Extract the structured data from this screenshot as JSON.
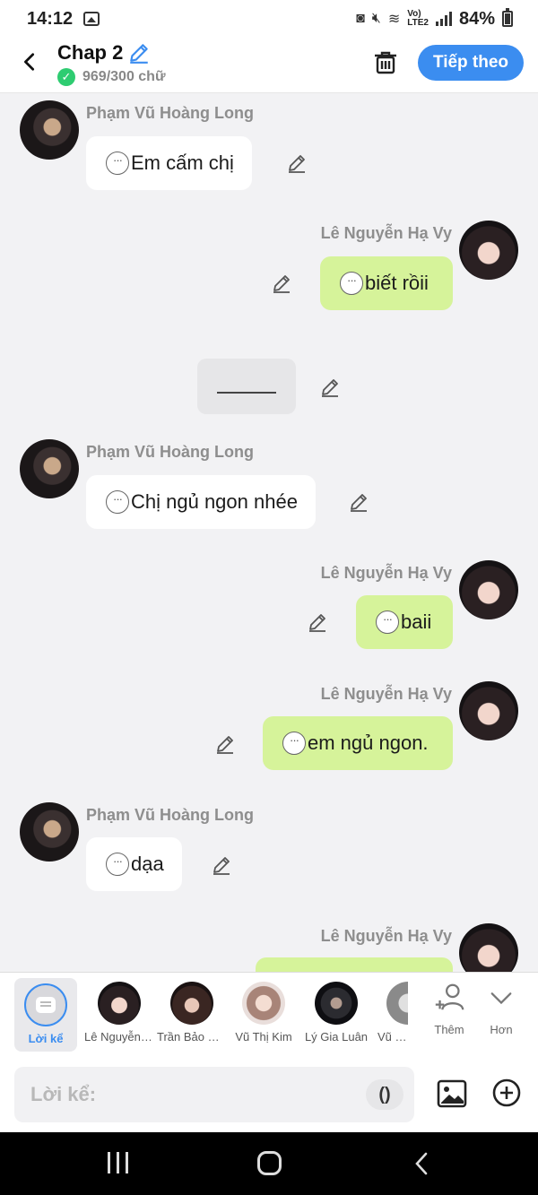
{
  "status_bar": {
    "time": "14:12",
    "network": "Vo)\nLTE2",
    "battery": "84%"
  },
  "header": {
    "title": "Chap 2",
    "word_count": "969/300 chữ",
    "next_label": "Tiếp theo"
  },
  "messages": [
    {
      "side": "left",
      "name": "Phạm Vũ Hoàng Long",
      "text": "Em cấm chị"
    },
    {
      "side": "right",
      "name": "Lê Nguyễn Hạ Vy",
      "text": "biết rồii"
    },
    {
      "side": "right",
      "name": "Lê Nguyễn Hạ Vy",
      "text": "baii"
    },
    {
      "side": "right",
      "name": "Lê Nguyễn Hạ Vy",
      "text": "em ngủ ngon."
    }
  ],
  "chat": {
    "m1_name": "Phạm Vũ Hoàng Long",
    "m1_text": "Em cấm chị",
    "m2_name": "Lê Nguyễn Hạ Vy",
    "m2_text": "biết rồii",
    "m3_name": "Phạm Vũ Hoàng Long",
    "m3_text": "Chị ngủ ngon nhée",
    "m4_name": "Lê Nguyễn Hạ Vy",
    "m4_text": "baii",
    "m5_name": "Lê Nguyễn Hạ Vy",
    "m5_text": "em ngủ ngon.",
    "m6_name": "Phạm Vũ Hoàng Long",
    "m6_text": "dạa",
    "m7_name": "Lê Nguyễn Hạ Vy"
  },
  "characters": {
    "narrator": "Lời kể",
    "c1": "Lê Nguyễn Hạ Vy",
    "c2": "Trần Bảo Ngọc",
    "c3": "Vũ Thị Kim",
    "c4": "Lý Gia Luân",
    "c5": "Vũ Hoàng",
    "add": "Thêm",
    "more": "Hơn"
  },
  "composer": {
    "placeholder": "Lời kể:",
    "paren": "()"
  },
  "colors": {
    "accent": "#3b8df0",
    "right_bubble": "#d6f39a",
    "left_bubble": "#ffffff",
    "check": "#2ecc71"
  }
}
